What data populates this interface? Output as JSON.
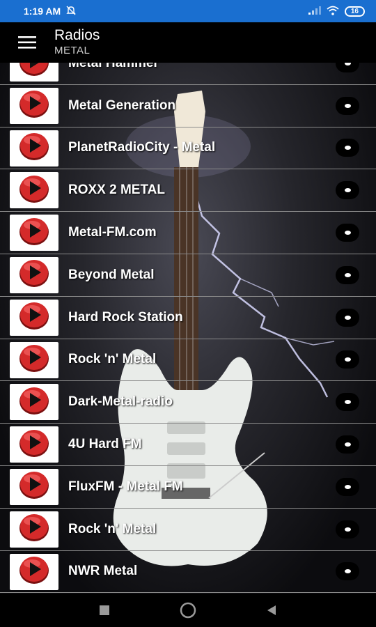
{
  "status_bar": {
    "time": "1:19 AM",
    "battery": "16"
  },
  "app_bar": {
    "title": "Radios",
    "subtitle": "METAL"
  },
  "stations": [
    {
      "name": "Metal Hammer"
    },
    {
      "name": "Metal Generation"
    },
    {
      "name": "PlanetRadioCity - Metal"
    },
    {
      "name": "ROXX 2 METAL"
    },
    {
      "name": "Metal-FM.com"
    },
    {
      "name": "Beyond Metal"
    },
    {
      "name": "Hard Rock Station"
    },
    {
      "name": "Rock 'n' Metal"
    },
    {
      "name": "Dark-Metal-radio"
    },
    {
      "name": "4U Hard FM"
    },
    {
      "name": "FluxFM - Metal FM"
    },
    {
      "name": "Rock 'n' Metal"
    },
    {
      "name": "NWR Metal"
    }
  ],
  "icons": {
    "menu": "hamburger-menu-icon",
    "station": "play-circle-icon",
    "options": "more-options-icon",
    "nav_recents": "square-icon",
    "nav_home": "circle-icon",
    "nav_back": "triangle-back-icon"
  },
  "colors": {
    "status_bar": "#1a6fd0",
    "play_red": "#d42a2a"
  }
}
